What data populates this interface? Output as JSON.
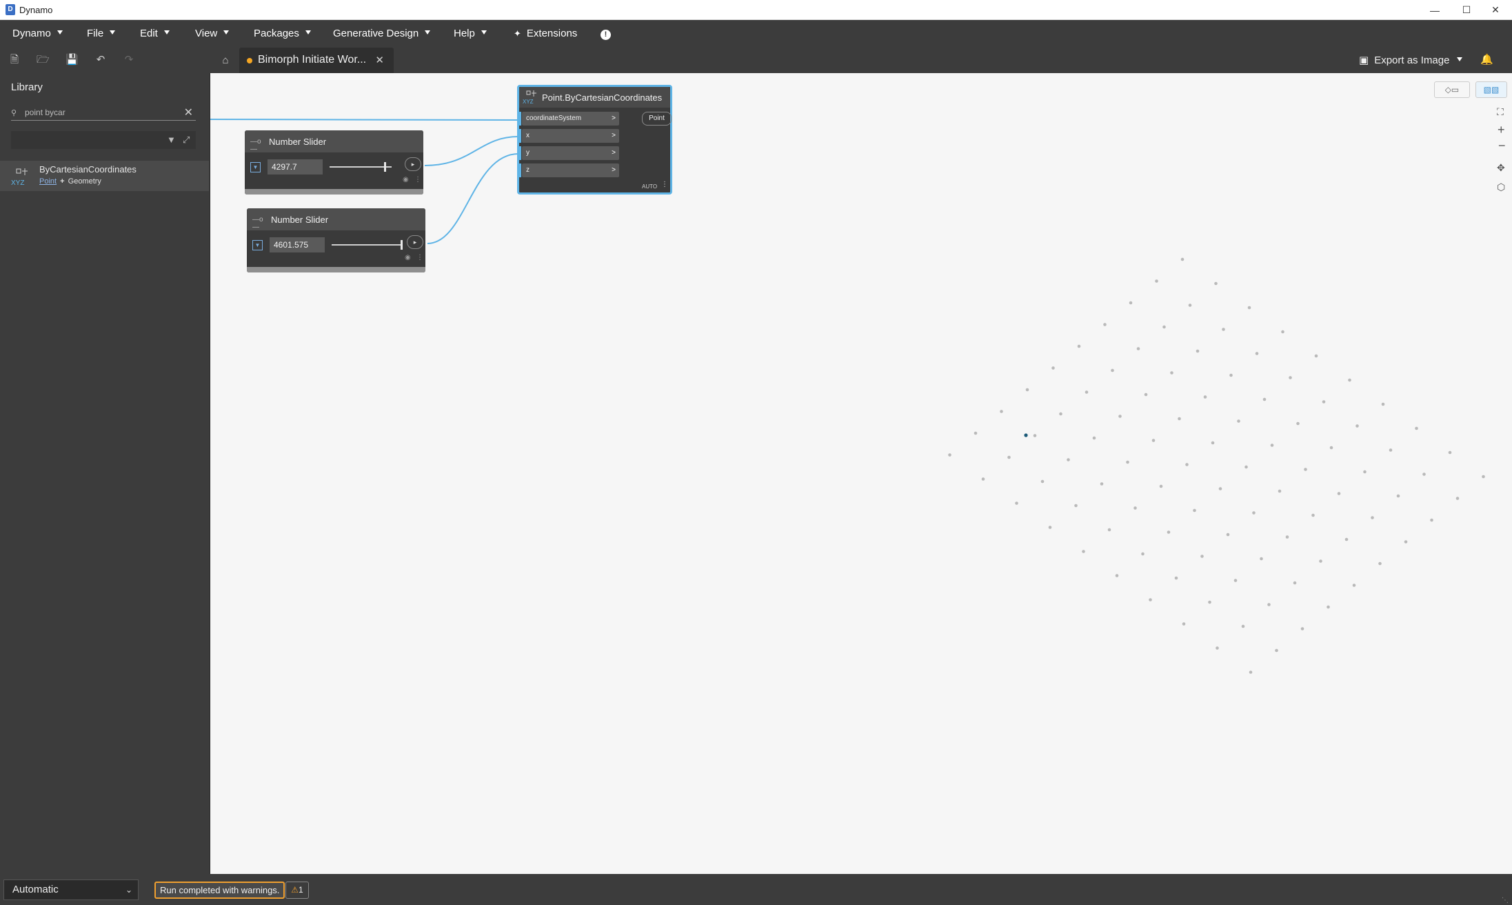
{
  "window": {
    "title": "Dynamo"
  },
  "menu": {
    "items": [
      {
        "label": "Dynamo",
        "has_caret": true
      },
      {
        "label": "File",
        "has_caret": true
      },
      {
        "label": "Edit",
        "has_caret": true
      },
      {
        "label": "View",
        "has_caret": true
      },
      {
        "label": "Packages",
        "has_caret": true
      },
      {
        "label": "Generative Design",
        "has_caret": true
      },
      {
        "label": "Help",
        "has_caret": true
      },
      {
        "label": "Extensions",
        "has_caret": false
      }
    ]
  },
  "toolbar": {
    "tab_name": "Bimorph Initiate Wor...",
    "tab_modified": true,
    "export_label": "Export as Image"
  },
  "library": {
    "title": "Library",
    "search_value": "point bycar",
    "result": {
      "name": "ByCartesianCoordinates",
      "category": "Point",
      "parent": "Geometry"
    }
  },
  "nodes": {
    "slider1": {
      "title": "Number Slider",
      "value": "4297.7",
      "fraction": 0.89
    },
    "slider2": {
      "title": "Number Slider",
      "value": "4601.575",
      "fraction": 0.98
    },
    "point": {
      "title": "Point.ByCartesianCoordinates",
      "inputs": [
        "coordinateSystem",
        "x",
        "y",
        "z"
      ],
      "output": "Point",
      "lacing": "AUTO"
    }
  },
  "status": {
    "run_mode": "Automatic",
    "message": "Run completed with warnings.",
    "warning_count": "1"
  },
  "colors": {
    "accent": "#5fb4e6",
    "warning": "#f0a030",
    "canvas": "#f6f6f6",
    "chrome": "#3c3c3c"
  }
}
